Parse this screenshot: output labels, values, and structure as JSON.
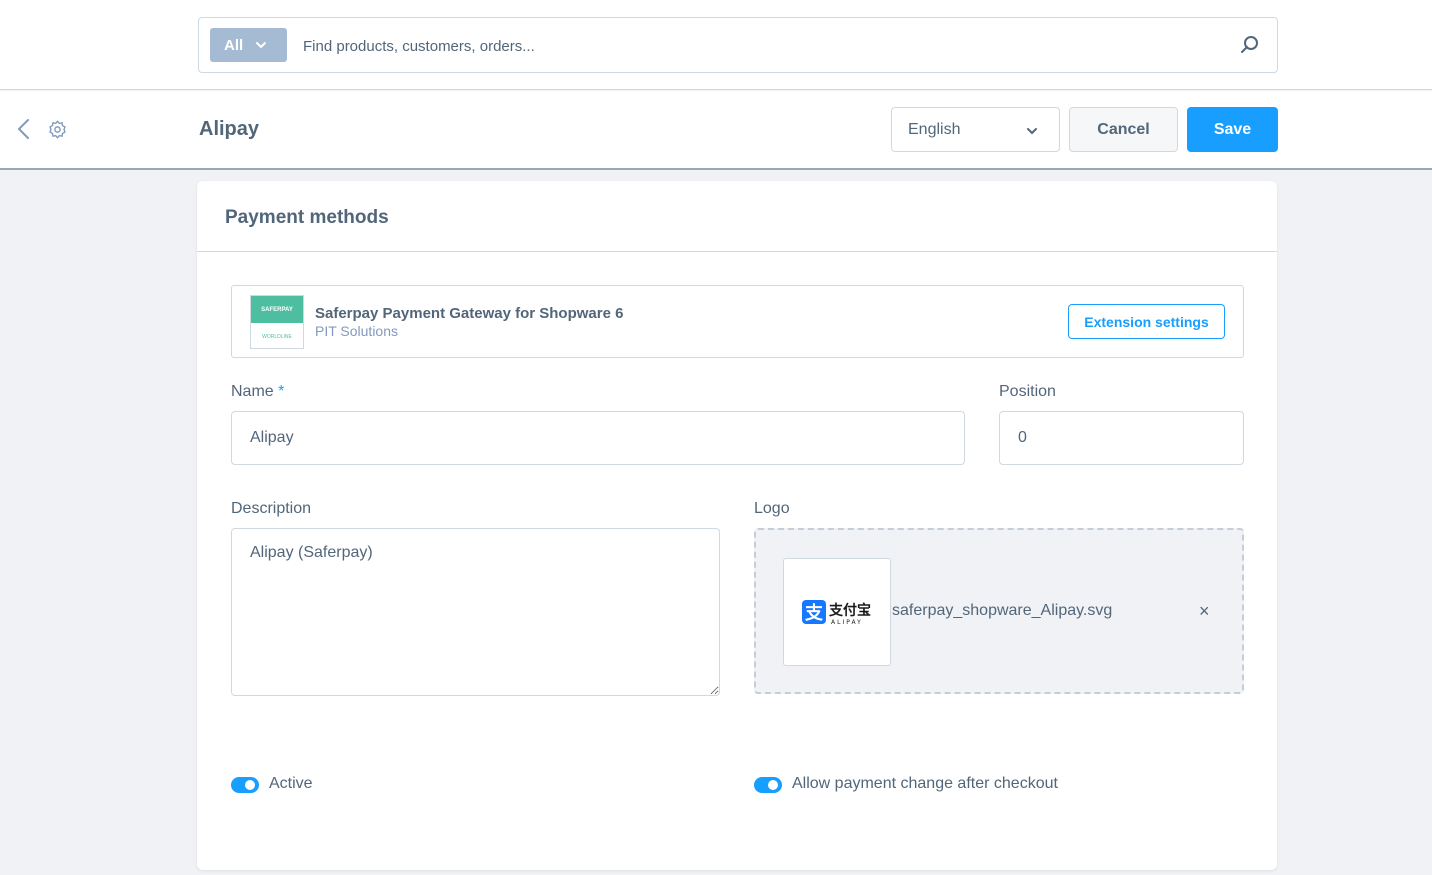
{
  "search": {
    "type_label": "All",
    "placeholder": "Find products, customers, orders..."
  },
  "smartbar": {
    "title": "Alipay",
    "language": "English",
    "cancel_label": "Cancel",
    "save_label": "Save"
  },
  "card": {
    "title": "Payment methods",
    "extension": {
      "logo_top": "SAFERPAY",
      "logo_bottom": "WORLDLINE",
      "name": "Saferpay Payment Gateway for Shopware 6",
      "vendor": "PIT Solutions",
      "settings_label": "Extension settings"
    },
    "name": {
      "label": "Name",
      "required_mark": "*",
      "value": "Alipay"
    },
    "position": {
      "label": "Position",
      "value": "0"
    },
    "description": {
      "label": "Description",
      "value": "Alipay (Saferpay)"
    },
    "logo": {
      "label": "Logo",
      "brand_cn": "支付宝",
      "brand_en": "ALIPAY",
      "filename": "saferpay_shopware_Alipay.svg",
      "remove": "×"
    },
    "toggles": {
      "active": {
        "label": "Active",
        "on": true
      },
      "allow_change": {
        "label": "Allow payment change after checkout",
        "on": true
      }
    }
  },
  "colors": {
    "primary": "#189eff",
    "text": "#52667a",
    "border": "#d1d9e0",
    "background": "#f0f2f5",
    "search_type_bg": "#a4bbd3",
    "alipay_blue": "#1677ff"
  }
}
